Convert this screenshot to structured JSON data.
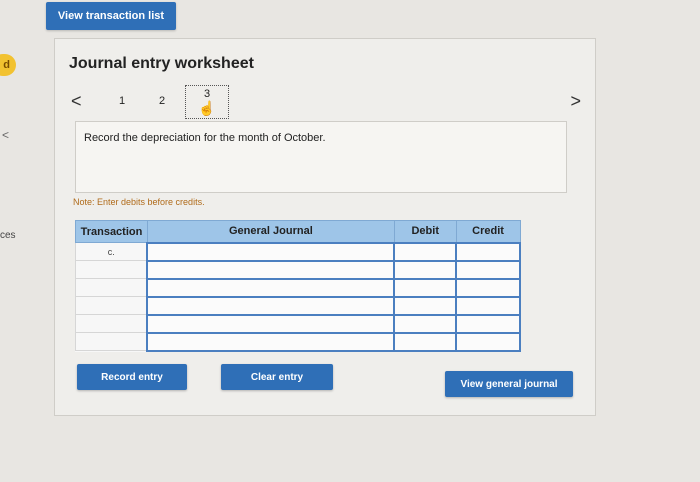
{
  "edge": {
    "badge": "d",
    "chevron": "<",
    "text": "ces"
  },
  "top_button": "View transaction list",
  "worksheet": {
    "title": "Journal entry worksheet",
    "pager": {
      "prev": "<",
      "pages": [
        "1",
        "2",
        "3"
      ],
      "active": "3",
      "next": ">"
    },
    "instruction": "Record the depreciation for the month of October.",
    "note": "Note: Enter debits before credits.",
    "table": {
      "headers": [
        "Transaction",
        "General Journal",
        "Debit",
        "Credit"
      ],
      "rows": [
        [
          "c.",
          "",
          "",
          ""
        ],
        [
          "",
          "",
          "",
          ""
        ],
        [
          "",
          "",
          "",
          ""
        ],
        [
          "",
          "",
          "",
          ""
        ],
        [
          "",
          "",
          "",
          ""
        ],
        [
          "",
          "",
          "",
          ""
        ]
      ]
    },
    "buttons": {
      "record": "Record entry",
      "clear": "Clear entry",
      "view_general_journal": "View general journal"
    }
  },
  "colors": {
    "button_blue": "#2f6fb7",
    "header_blue": "#9ec5e8",
    "note_orange": "#b06b1a"
  }
}
